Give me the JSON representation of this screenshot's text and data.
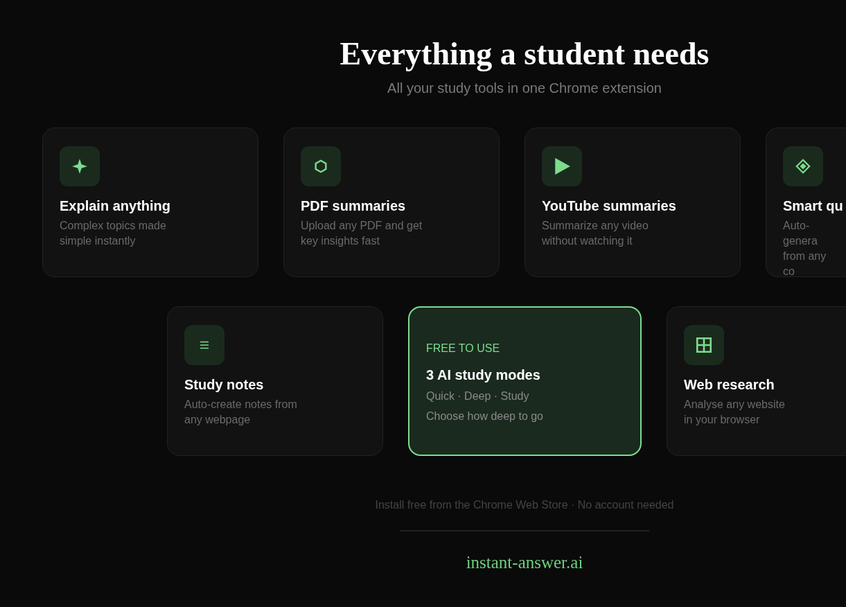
{
  "heading": {
    "title": "Everything a student needs",
    "subtitle": "All your study tools in one Chrome extension"
  },
  "rows": [
    {
      "cards": [
        {
          "kind": "feature",
          "title": "Explain anything",
          "description": "Complex topics made\nsimple instantly"
        },
        {
          "kind": "feature",
          "title": "PDF summaries",
          "description": "Upload any PDF and get\nkey insights fast"
        },
        {
          "kind": "feature",
          "title": "YouTube summaries",
          "description": "Summarize any video\nwithout watching it"
        },
        {
          "kind": "feature",
          "title": "Smart qu",
          "description": "Auto-genera\nfrom any co"
        }
      ]
    },
    {
      "cards": [
        {
          "kind": "feature",
          "title": "Study notes",
          "description": "Auto-create notes from\nany webpage"
        },
        {
          "kind": "highlight",
          "badge": "FREE TO USE",
          "title": "3 AI study modes",
          "lines": [
            "Quick · Deep · Study",
            "Choose how deep to go"
          ]
        },
        {
          "kind": "feature",
          "title": "Web research",
          "description": "Analyse any website\nin your browser"
        }
      ]
    }
  ],
  "footer": {
    "note": "Install free from the Chrome Web Store · No account needed",
    "brand": "instant-answer.ai"
  }
}
